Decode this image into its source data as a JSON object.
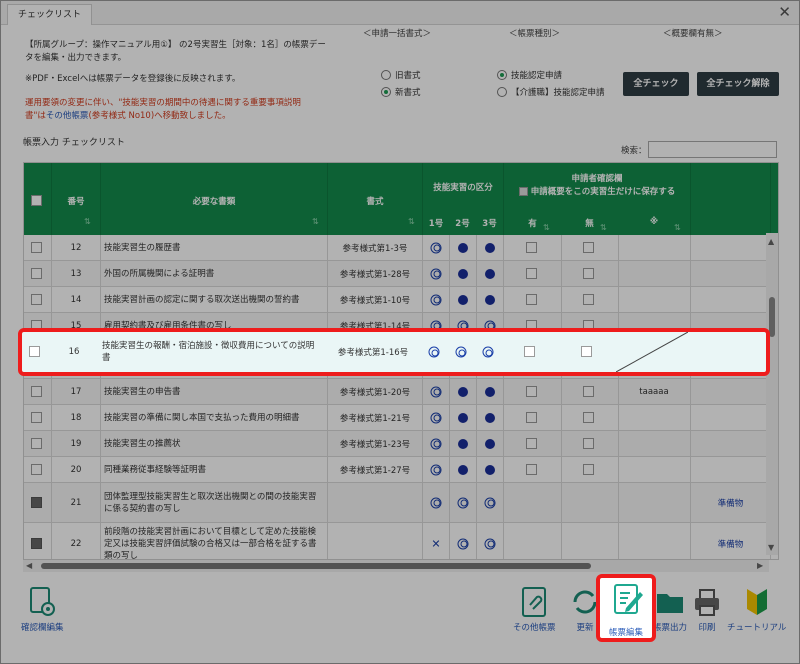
{
  "window": {
    "tab_label": "チェックリスト",
    "close": "✕"
  },
  "header": {
    "col_apply": "＜申請一括書式＞",
    "col_type": "＜帳票種別＞",
    "col_summary": "＜概要欄有無＞",
    "intro_line1": "【所属グループ：操作マニュアル用①】 の2号実習生［対象：1名］の帳票デー",
    "intro_line2": "タを編集・出力できます。",
    "note_pdf": "※PDF・Excelへは帳票データを登録後に反映されます。",
    "red_line1": "運用要領の変更に伴い、\"技能実習の期間中の待遇に関する重要事項説明",
    "red_line2a": "書\"は",
    "red_line2_link": "その他帳票",
    "red_line2b": "(参考様式 No10)へ移動致しました。"
  },
  "format_radios": {
    "old": "旧書式",
    "new": "新書式",
    "selected": "new"
  },
  "type_radios": {
    "skill": "技能認定申請",
    "care": "【介護職】技能認定申請",
    "selected": "skill"
  },
  "buttons": {
    "check_all": "全チェック",
    "uncheck_all": "全チェック解除"
  },
  "grid": {
    "title": "帳票入力 チェックリスト",
    "search_label": "検索：",
    "search_value": ""
  },
  "columns": {
    "no": "番号",
    "docs": "必要な書類",
    "format": "書式",
    "category": "技能実習の区分",
    "no1": "1号",
    "no2": "2号",
    "no3": "3号",
    "confirm1": "申請者確認欄",
    "confirm2": "申請概要をこの実習生だけに保存する",
    "yes": "有",
    "no_": "無",
    "note": "※"
  },
  "rows": [
    {
      "no": "12",
      "name": "技能実習生の履歴書",
      "format": "参考様式第1-3号",
      "m1": "dbl",
      "m2": "dot",
      "m3": "dot",
      "note": "",
      "extra": ""
    },
    {
      "no": "13",
      "name": "外国の所属機関による証明書",
      "format": "参考様式第1-28号",
      "m1": "dbl",
      "m2": "dot",
      "m3": "dot",
      "note": "",
      "extra": ""
    },
    {
      "no": "14",
      "name": "技能実習計画の認定に関する取次送出機関の誓約書",
      "format": "参考様式第1-10号",
      "m1": "dbl",
      "m2": "dot",
      "m3": "dot",
      "note": "",
      "extra": ""
    },
    {
      "no": "15",
      "name": "雇用契約書及び雇用条件書の写し",
      "format": "参考様式第1-14号",
      "m1": "dbl",
      "m2": "dbl",
      "m3": "dbl",
      "note": "",
      "extra": ""
    },
    {
      "no": "16",
      "name": "技能実習生の報酬・宿泊施設・徴収費用についての説明書",
      "format": "参考様式第1-16号",
      "m1": "dbl",
      "m2": "dbl",
      "m3": "dbl",
      "note": "",
      "extra": ""
    },
    {
      "no": "17",
      "name": "技能実習生の申告書",
      "format": "参考様式第1-20号",
      "m1": "dbl",
      "m2": "dot",
      "m3": "dot",
      "note": "taaaaa",
      "extra": ""
    },
    {
      "no": "18",
      "name": "技能実習の準備に関し本国で支払った費用の明細書",
      "format": "参考様式第1-21号",
      "m1": "dbl",
      "m2": "dot",
      "m3": "dot",
      "note": "",
      "extra": ""
    },
    {
      "no": "19",
      "name": "技能実習生の推薦状",
      "format": "参考様式第1-23号",
      "m1": "dbl",
      "m2": "dot",
      "m3": "dot",
      "note": "",
      "extra": ""
    },
    {
      "no": "20",
      "name": "同種業務従事経験等証明書",
      "format": "参考様式第1-27号",
      "m1": "dbl",
      "m2": "dot",
      "m3": "dot",
      "note": "",
      "extra": ""
    },
    {
      "no": "21",
      "name": "団体監理型技能実習生と取次送出機関との間の技能実習に係る契約書の写し",
      "format": "",
      "m1": "dbl",
      "m2": "dbl",
      "m3": "dbl",
      "note": "",
      "extra": "準備物"
    },
    {
      "no": "22",
      "name": "前段階の技能実習計画において目標として定めた技能検定又は技能実習評価試験の合格又は一部合格を証する書類の写し",
      "format": "",
      "m1": "cross",
      "m2": "dbl",
      "m3": "dbl",
      "note": "",
      "extra": "準備物"
    }
  ],
  "toolbar": {
    "confirm_edit": "確認欄編集",
    "other_docs": "その他帳票",
    "update": "更新",
    "edit_doc": "帳票編集",
    "doc_output": "帳票出力",
    "print": "印刷",
    "tutorial": "チュートリアル"
  },
  "colors": {
    "header_green": "#138c4c",
    "highlight_red": "#ee1c1c",
    "mark_blue": "#1a3fa8"
  }
}
